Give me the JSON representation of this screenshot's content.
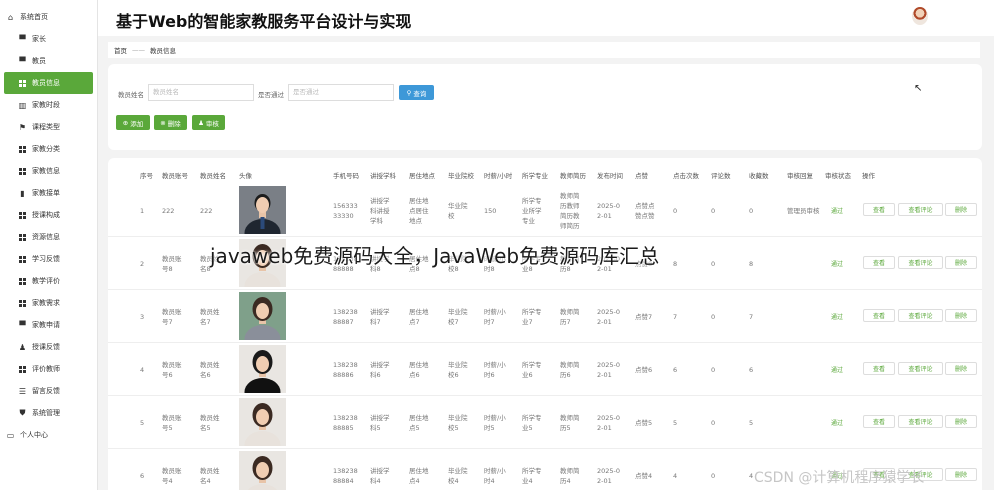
{
  "header": {
    "title": "基于Web的智能家教服务平台设计与实现"
  },
  "sidebar": {
    "items": [
      {
        "label": "系统首页",
        "icon": "home-icon"
      },
      {
        "label": "家长",
        "icon": "monitor-icon"
      },
      {
        "label": "教员",
        "icon": "monitor-icon"
      },
      {
        "label": "教员信息",
        "icon": "grid-icon",
        "active": true
      },
      {
        "label": "家教时段",
        "icon": "book-icon"
      },
      {
        "label": "课程类型",
        "icon": "flag-icon"
      },
      {
        "label": "家教分类",
        "icon": "grid-icon"
      },
      {
        "label": "家教信息",
        "icon": "grid-icon"
      },
      {
        "label": "家教接单",
        "icon": "bar-chart-icon"
      },
      {
        "label": "授课构成",
        "icon": "grid-icon"
      },
      {
        "label": "资源信息",
        "icon": "grid-icon"
      },
      {
        "label": "学习反馈",
        "icon": "grid-icon"
      },
      {
        "label": "教学评价",
        "icon": "grid-icon"
      },
      {
        "label": "家教需求",
        "icon": "grid-icon"
      },
      {
        "label": "家教申请",
        "icon": "monitor-icon"
      },
      {
        "label": "授课反馈",
        "icon": "user-icon"
      },
      {
        "label": "评价教师",
        "icon": "grid-icon"
      },
      {
        "label": "留言反馈",
        "icon": "sliders-icon"
      },
      {
        "label": "系统管理",
        "icon": "shield-icon"
      },
      {
        "label": "个人中心",
        "icon": "window-icon"
      }
    ]
  },
  "breadcrumb": {
    "home": "首页",
    "sep": "——",
    "current": "教员信息"
  },
  "search": {
    "label1": "教员姓名",
    "placeholder1": "教员姓名",
    "label2": "是否通过",
    "placeholder2": "是否通过",
    "query_label": "查询",
    "add_label": "添加",
    "delete_label": "删除",
    "review_label": "审核"
  },
  "table": {
    "headers": [
      "序号",
      "教员账号",
      "教员姓名",
      "头像",
      "手机号码",
      "讲授学科",
      "居住地点",
      "毕业院校",
      "时薪/小时",
      "所学专业",
      "教师简历",
      "发布时间",
      "点赞",
      "点击次数",
      "评论数",
      "收藏数",
      "审核回复",
      "审核状态",
      "操作"
    ],
    "rows": [
      {
        "no": "1",
        "account": "222",
        "name": "222",
        "phone": "156333\n33330",
        "subject": "讲授学\n科讲授\n学科",
        "address": "居住地\n点居住\n地点",
        "school": "华业院\n校",
        "wage": "150",
        "major": "所学专\n业所学\n专业",
        "resume": "教师简\n历教师\n简历教\n师简历",
        "date": "2025-0\n2-01",
        "like": "点赞点\n赞点赞",
        "clicks": "0",
        "comments": "0",
        "favs": "0",
        "reply": "管理员审核",
        "status": "通过",
        "photo": "man-suit"
      },
      {
        "no": "2",
        "account": "教员账\n号8",
        "name": "教员姓\n名8",
        "phone": "138238\n88888",
        "subject": "讲授学\n科8",
        "address": "居住地\n点8",
        "school": "毕业院\n校8",
        "wage": "时薪/小\n时8",
        "major": "所学专\n业8",
        "resume": "教师简\n历8",
        "date": "2025-0\n2-01",
        "like": "点赞8",
        "clicks": "8",
        "comments": "0",
        "favs": "8",
        "reply": "",
        "status": "通过",
        "photo": "woman-a"
      },
      {
        "no": "3",
        "account": "教员账\n号7",
        "name": "教员姓\n名7",
        "phone": "138238\n88887",
        "subject": "讲授学\n科7",
        "address": "居住地\n点7",
        "school": "毕业院\n校7",
        "wage": "时薪/小\n时7",
        "major": "所学专\n业7",
        "resume": "教师简\n历7",
        "date": "2025-0\n2-01",
        "like": "点赞7",
        "clicks": "7",
        "comments": "0",
        "favs": "7",
        "reply": "",
        "status": "通过",
        "photo": "woman-b"
      },
      {
        "no": "4",
        "account": "教员账\n号6",
        "name": "教员姓\n名6",
        "phone": "138238\n88886",
        "subject": "讲授学\n科6",
        "address": "居住地\n点6",
        "school": "毕业院\n校6",
        "wage": "时薪/小\n时6",
        "major": "所学专\n业6",
        "resume": "教师简\n历6",
        "date": "2025-0\n2-01",
        "like": "点赞6",
        "clicks": "6",
        "comments": "0",
        "favs": "6",
        "reply": "",
        "status": "通过",
        "photo": "woman-c"
      },
      {
        "no": "5",
        "account": "教员账\n号5",
        "name": "教员姓\n名5",
        "phone": "138238\n88885",
        "subject": "讲授学\n科5",
        "address": "居住地\n点5",
        "school": "毕业院\n校5",
        "wage": "时薪/小\n时5",
        "major": "所学专\n业5",
        "resume": "教师简\n历5",
        "date": "2025-0\n2-01",
        "like": "点赞5",
        "clicks": "5",
        "comments": "0",
        "favs": "5",
        "reply": "",
        "status": "通过",
        "photo": "woman-d"
      },
      {
        "no": "6",
        "account": "教员账\n号4",
        "name": "教员姓\n名4",
        "phone": "138238\n88884",
        "subject": "讲授学\n科4",
        "address": "居住地\n点4",
        "school": "毕业院\n校4",
        "wage": "时薪/小\n时4",
        "major": "所学专\n业4",
        "resume": "教师简\n历4",
        "date": "2025-0\n2-01",
        "like": "点赞4",
        "clicks": "4",
        "comments": "0",
        "favs": "4",
        "reply": "",
        "status": "通过",
        "photo": "woman-e"
      }
    ],
    "actions": {
      "view": "查看",
      "view_comments": "查看评论",
      "delete": "删除"
    }
  },
  "overlay": {
    "text": "javaweb免费源码大全，JavaWeb免费源码库汇总"
  },
  "watermark": {
    "text": "CSDN @计算机程序猿学长"
  },
  "colors": {
    "accent_green": "#5aa83a",
    "query_blue": "#3d98d8"
  }
}
